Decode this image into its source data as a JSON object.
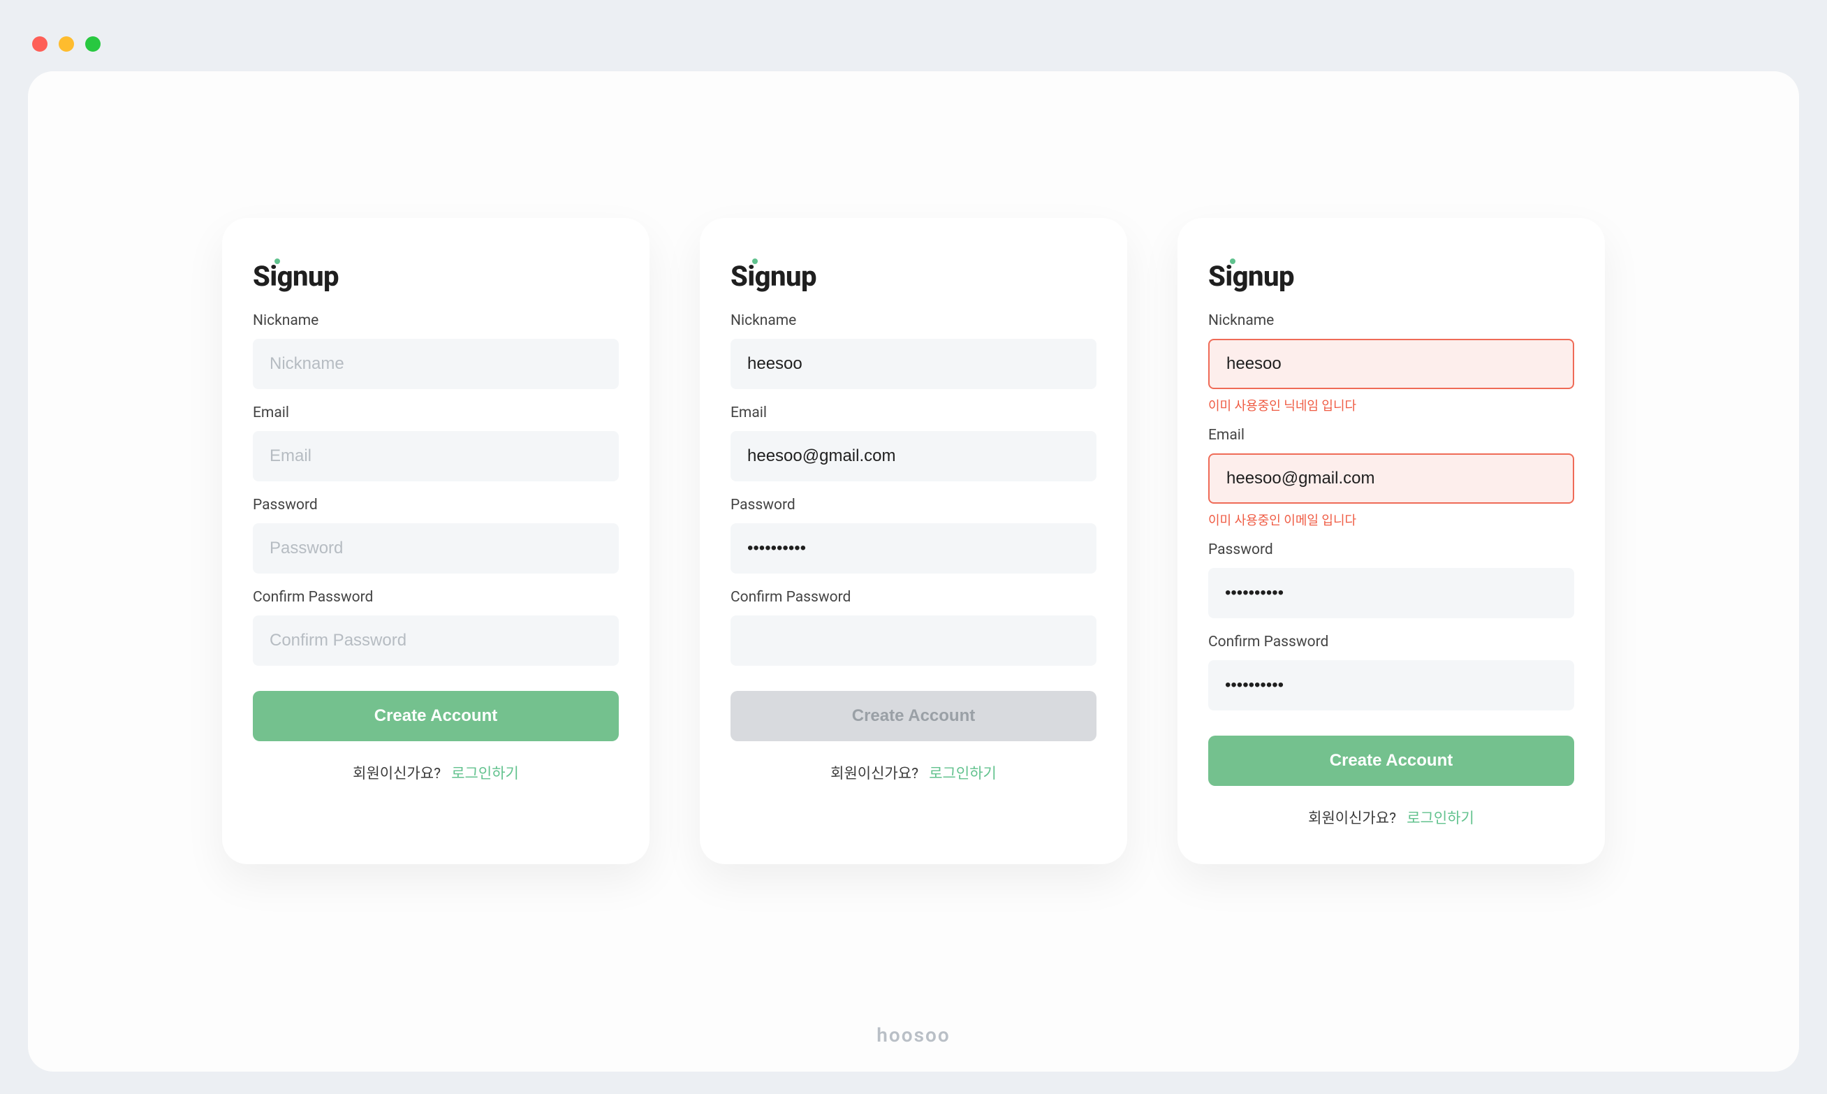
{
  "colors": {
    "accent": "#74c18e",
    "error": "#ef5b43",
    "inputBg": "#f4f6f8",
    "inputErrorBg": "#fdeeec",
    "inputErrorBorder": "#ef6b57"
  },
  "brand": {
    "text": "hoosoo"
  },
  "cards": [
    {
      "title": "Signup",
      "fields": {
        "nickname": {
          "label": "Nickname",
          "placeholder": "Nickname",
          "value": "",
          "error": null
        },
        "email": {
          "label": "Email",
          "placeholder": "Email",
          "value": "",
          "error": null
        },
        "password": {
          "label": "Password",
          "placeholder": "Password",
          "value": "",
          "error": null
        },
        "confirm": {
          "label": "Confirm Password",
          "placeholder": "Confirm Password",
          "value": "",
          "error": null
        }
      },
      "button": {
        "label": "Create Account",
        "disabled": false
      },
      "footer": {
        "prompt": "회원이신가요?",
        "link": "로그인하기"
      }
    },
    {
      "title": "Signup",
      "fields": {
        "nickname": {
          "label": "Nickname",
          "placeholder": "",
          "value": "heesoo",
          "error": null
        },
        "email": {
          "label": "Email",
          "placeholder": "",
          "value": "heesoo@gmail.com",
          "error": null
        },
        "password": {
          "label": "Password",
          "placeholder": "",
          "value": "••••••••••",
          "error": null
        },
        "confirm": {
          "label": "Confirm Password",
          "placeholder": "",
          "value": "",
          "error": null
        }
      },
      "button": {
        "label": "Create Account",
        "disabled": true
      },
      "footer": {
        "prompt": "회원이신가요?",
        "link": "로그인하기"
      }
    },
    {
      "title": "Signup",
      "fields": {
        "nickname": {
          "label": "Nickname",
          "placeholder": "",
          "value": "heesoo",
          "error": "이미 사용중인 닉네임 입니다"
        },
        "email": {
          "label": "Email",
          "placeholder": "",
          "value": "heesoo@gmail.com",
          "error": "이미 사용중인 이메일 입니다"
        },
        "password": {
          "label": "Password",
          "placeholder": "",
          "value": "••••••••••",
          "error": null
        },
        "confirm": {
          "label": "Confirm Password",
          "placeholder": "",
          "value": "••••••••••",
          "error": null
        }
      },
      "button": {
        "label": "Create Account",
        "disabled": false
      },
      "footer": {
        "prompt": "회원이신가요?",
        "link": "로그인하기"
      }
    }
  ]
}
